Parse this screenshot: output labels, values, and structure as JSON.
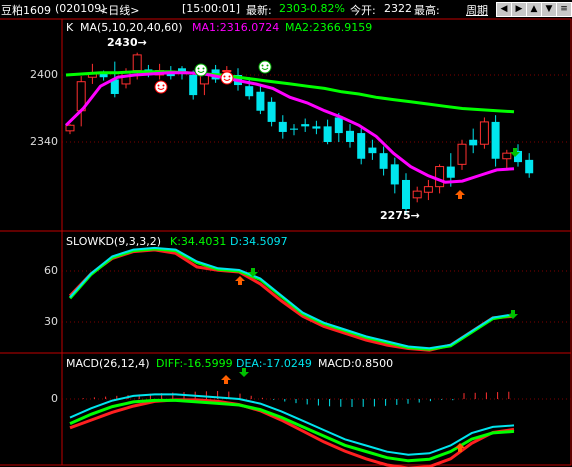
{
  "header": {
    "symbol": "豆粕1609",
    "code": "(020109)",
    "period": "<日线>",
    "time": "[15:00:01]",
    "latest_label": "最新:",
    "latest_value": "2303",
    "change_pct": "-0.82%",
    "open_label": "今开:",
    "open_value": "2322",
    "high_label": "最高:",
    "cycle_label": "周期",
    "nav_icons": [
      "arrow-left-icon",
      "arrow-right-icon",
      "arrow-up-icon",
      "arrow-down-icon",
      "menu-icon"
    ]
  },
  "main_panel": {
    "label": "K",
    "ma_label": "MA(5,10,20,40,60)",
    "ma1": "MA1:2316.0724",
    "ma2": "MA2:2366.9159",
    "ticks": [
      "2400",
      "2340"
    ],
    "high_annotation": "2430",
    "low_annotation": "2275"
  },
  "kd_panel": {
    "label": "SLOWKD(9,3,3,2)",
    "k": "K:34.4031",
    "d": "D:34.5097",
    "ticks": [
      "60",
      "30"
    ]
  },
  "macd_panel": {
    "label": "MACD(26,12,4)",
    "diff": "DIFF:-16.5999",
    "dea": "DEA:-17.0249",
    "macd": "MACD:0.8500",
    "ticks": [
      "0"
    ]
  },
  "colors": {
    "up": "#ff3030",
    "down": "#00e5ee",
    "ma1": "#ff00ff",
    "ma2": "#00ff00",
    "border": "#c00000",
    "grid": "#800000"
  },
  "chart_data": [
    {
      "type": "candlestick",
      "title": "K",
      "series": [
        {
          "name": "MA1",
          "values": [
            2355,
            2370,
            2390,
            2398,
            2400,
            2401,
            2402,
            2402,
            2401,
            2398,
            2395,
            2392,
            2388,
            2380,
            2375,
            2368,
            2362,
            2355,
            2345,
            2330,
            2318,
            2310,
            2304,
            2305,
            2310,
            2315,
            2316
          ]
        },
        {
          "name": "MA2",
          "values": [
            2400,
            2401,
            2402,
            2402,
            2403,
            2403,
            2403,
            2402,
            2401,
            2400,
            2398,
            2396,
            2394,
            2392,
            2390,
            2388,
            2385,
            2383,
            2380,
            2378,
            2376,
            2374,
            2372,
            2370,
            2369,
            2368,
            2367
          ]
        }
      ],
      "ylim": [
        2270,
        2435
      ]
    },
    {
      "type": "line",
      "title": "SLOWKD(9,3,3,2)",
      "series": [
        {
          "name": "K",
          "values": [
            44,
            58,
            68,
            72,
            73,
            72,
            65,
            61,
            60,
            55,
            45,
            35,
            29,
            25,
            21,
            18,
            15,
            14,
            16,
            24,
            32,
            34
          ]
        },
        {
          "name": "D",
          "values": [
            46,
            59,
            68,
            72,
            73,
            71,
            63,
            61,
            60,
            53,
            43,
            34,
            28,
            24,
            20,
            17,
            15,
            14,
            17,
            25,
            33,
            34
          ]
        }
      ],
      "ylim": [
        10,
        80
      ]
    },
    {
      "type": "line",
      "title": "MACD(26,12,4)",
      "series": [
        {
          "name": "DIFF",
          "values": [
            -12,
            -6,
            -1,
            2,
            3,
            3,
            2,
            1,
            0,
            -3,
            -8,
            -14,
            -20,
            -26,
            -30,
            -34,
            -36,
            -35,
            -30,
            -22,
            -18,
            -17
          ]
        },
        {
          "name": "DEA",
          "values": [
            -16,
            -11,
            -6,
            -2,
            1,
            2,
            2,
            1,
            -1,
            -5,
            -11,
            -18,
            -25,
            -31,
            -36,
            -40,
            -42,
            -41,
            -36,
            -26,
            -19,
            -17
          ]
        }
      ],
      "ylim": [
        -45,
        10
      ]
    }
  ]
}
